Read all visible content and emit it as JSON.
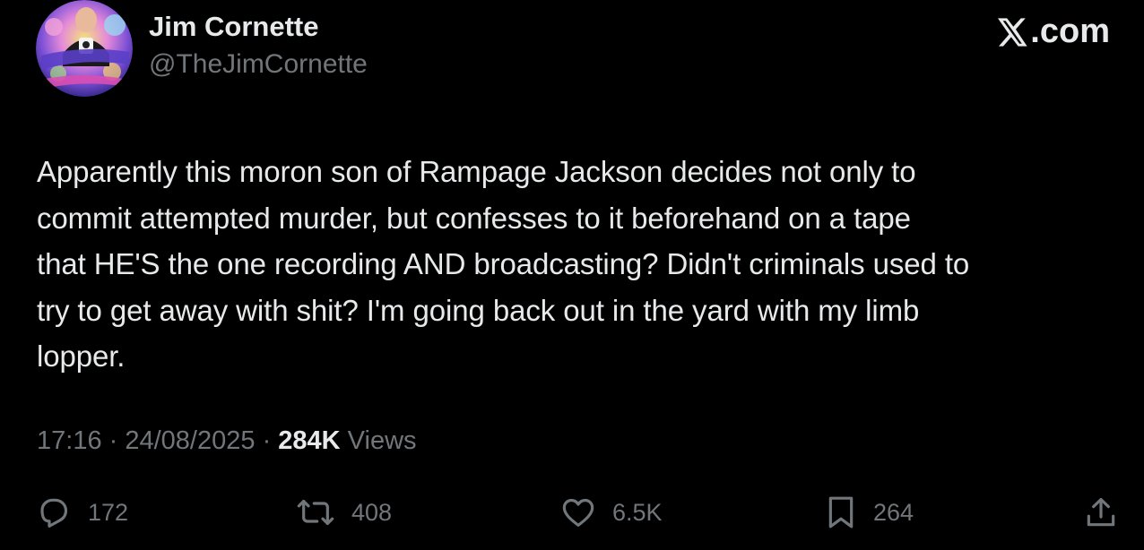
{
  "author": {
    "display_name": "Jim Cornette",
    "handle": "@TheJimCornette",
    "avatar_icon": "profile-avatar"
  },
  "brand": {
    "label": ".com",
    "icon": "x-logo-icon"
  },
  "tweet": {
    "text": "Apparently this moron son of Rampage Jackson decides not only to\ncommit attempted murder, but confesses to it beforehand on a tape\nthat HE'S the one recording AND broadcasting? Didn't criminals used to\ntry to get away with shit? I'm going back out in the yard with my limb\nlopper."
  },
  "meta": {
    "time": "17:16",
    "sep1": " · ",
    "date": "24/08/2025",
    "sep2": " · ",
    "views_count": "284K",
    "views_label": " Views"
  },
  "actions": {
    "replies": "172",
    "reposts": "408",
    "likes": "6.5K",
    "bookmarks": "264"
  },
  "colors": {
    "background": "#000000",
    "text_primary": "#e7e9ea",
    "text_secondary": "#71767b"
  }
}
